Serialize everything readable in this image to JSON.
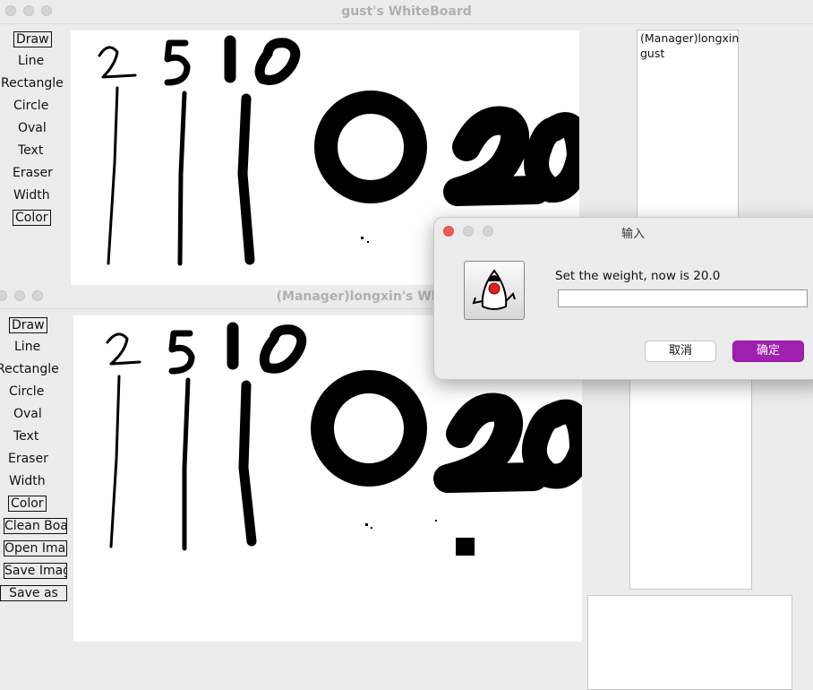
{
  "gust_window": {
    "title": "gust's WhiteBoard",
    "tools": [
      "Draw",
      "Line",
      "Rectangle",
      "Circle",
      "Oval",
      "Text",
      "Eraser",
      "Width",
      "Color"
    ],
    "users": [
      "(Manager)longxin",
      "gust"
    ]
  },
  "manager_window": {
    "title": "(Manager)longxin's WhiteBoard",
    "tools": [
      "Draw",
      "Line",
      "Rectangle",
      "Circle",
      "Oval",
      "Text",
      "Eraser",
      "Width",
      "Color"
    ],
    "file_buttons": [
      "Clean Board",
      "Open Image",
      "Save Image",
      "Save as"
    ]
  },
  "dialog": {
    "title": "输入",
    "icon": "java-duke-icon",
    "message": "Set the weight, now is 20.0",
    "input_value": "",
    "cancel_label": "取消",
    "ok_label": "确定",
    "ok_color": "#a020b0"
  },
  "canvas_content": {
    "digits": [
      "2",
      "5",
      "10",
      "20"
    ]
  }
}
